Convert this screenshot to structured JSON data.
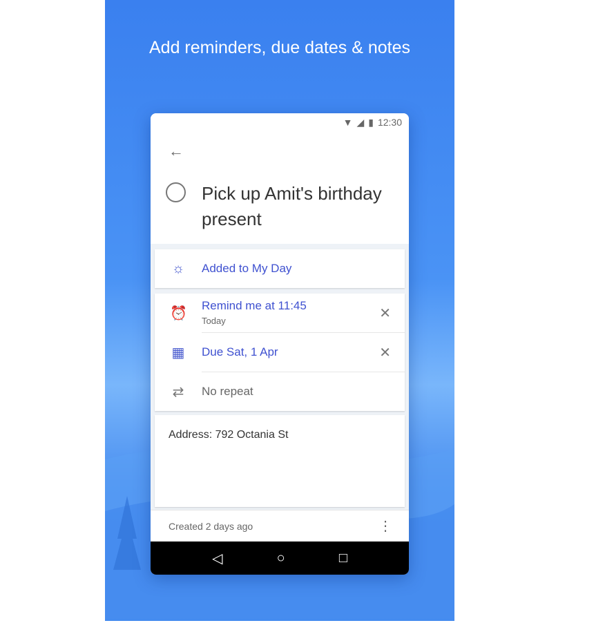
{
  "headline": "Add reminders, due dates & notes",
  "status": {
    "time": "12:30"
  },
  "task": {
    "title": "Pick up Amit's birthday present"
  },
  "my_day": {
    "label": "Added to My Day"
  },
  "reminder": {
    "label": "Remind me at 11:45",
    "sub": "Today"
  },
  "due": {
    "label": "Due Sat, 1 Apr"
  },
  "repeat": {
    "label": "No repeat"
  },
  "note": {
    "text": "Address: 792 Octania St"
  },
  "footer": {
    "created": "Created 2 days ago"
  },
  "colors": {
    "accent": "#3f51d0",
    "background": "#3a80ef"
  }
}
